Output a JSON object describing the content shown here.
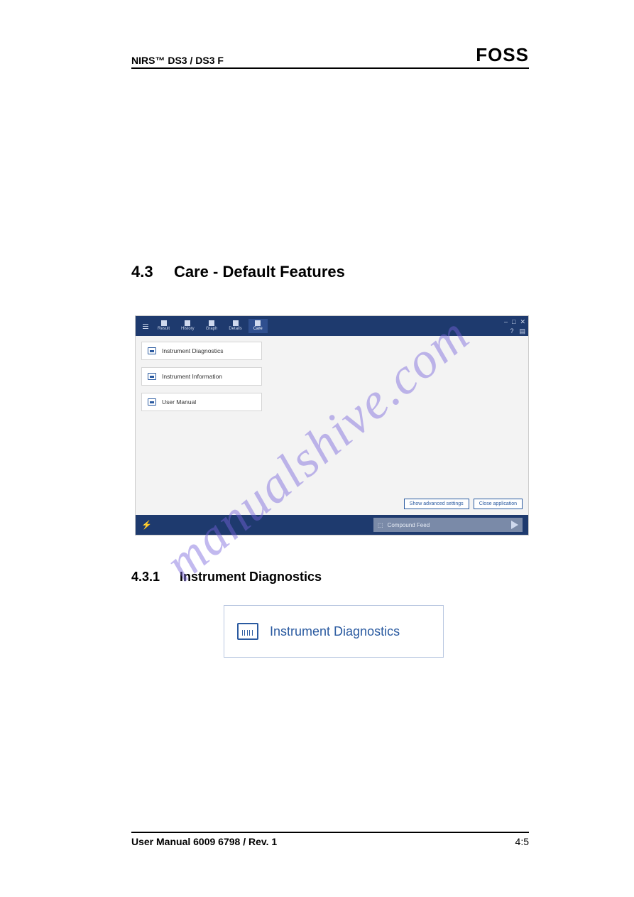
{
  "header": {
    "left": "NIRS™ DS3 / DS3 F",
    "right": "FOSS"
  },
  "section": {
    "number": "4.3",
    "title": "Care - Default Features"
  },
  "screenshot": {
    "tabs": [
      {
        "label": "Result"
      },
      {
        "label": "History"
      },
      {
        "label": "Graph"
      },
      {
        "label": "Details"
      },
      {
        "label": "Care"
      }
    ],
    "win_min": "–",
    "win_max": "□",
    "win_close": "✕",
    "help": "?",
    "doc": "▤",
    "list": [
      {
        "label": "Instrument Diagnostics"
      },
      {
        "label": "Instrument Information"
      },
      {
        "label": "User Manual"
      }
    ],
    "buttons": {
      "advanced": "Show advanced settings",
      "close": "Close application"
    },
    "footer_title": "Compound Feed"
  },
  "subsection": {
    "number": "4.3.1",
    "title": "Instrument Diagnostics"
  },
  "big_button": {
    "label": "Instrument Diagnostics"
  },
  "footer": {
    "left": "User Manual 6009 6798 / Rev. 1",
    "right": "4:5"
  },
  "watermark": "manualshive.com"
}
